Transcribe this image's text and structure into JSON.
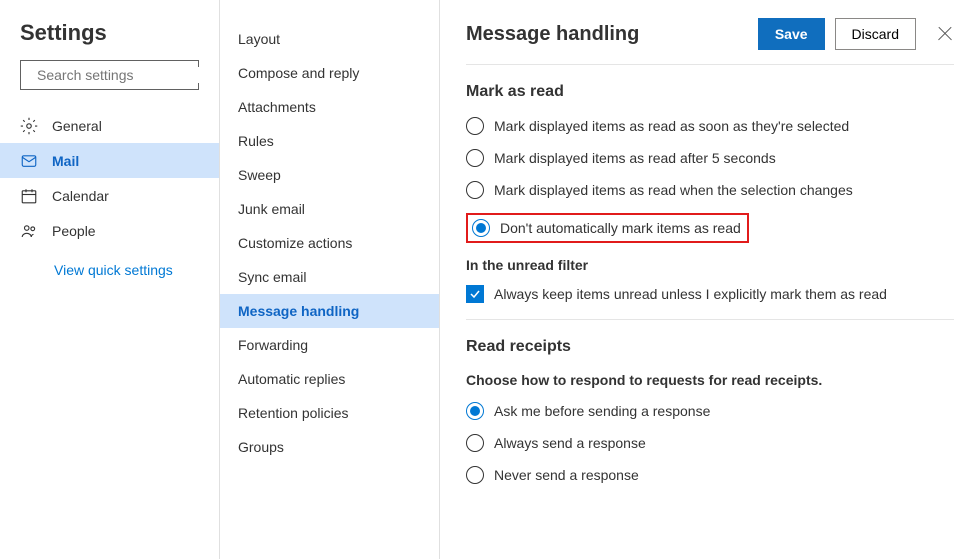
{
  "header": {
    "title": "Settings",
    "search_placeholder": "Search settings",
    "quick_settings": "View quick settings"
  },
  "nav": [
    {
      "label": "General",
      "selected": false
    },
    {
      "label": "Mail",
      "selected": true
    },
    {
      "label": "Calendar",
      "selected": false
    },
    {
      "label": "People",
      "selected": false
    }
  ],
  "subnav": [
    {
      "label": "Layout"
    },
    {
      "label": "Compose and reply"
    },
    {
      "label": "Attachments"
    },
    {
      "label": "Rules"
    },
    {
      "label": "Sweep"
    },
    {
      "label": "Junk email"
    },
    {
      "label": "Customize actions"
    },
    {
      "label": "Sync email"
    },
    {
      "label": "Message handling",
      "selected": true
    },
    {
      "label": "Forwarding"
    },
    {
      "label": "Automatic replies"
    },
    {
      "label": "Retention policies"
    },
    {
      "label": "Groups"
    }
  ],
  "main": {
    "title": "Message handling",
    "save": "Save",
    "discard": "Discard",
    "mark_as_read_heading": "Mark as read",
    "mark_options": [
      {
        "label": "Mark displayed items as read as soon as they're selected",
        "checked": false
      },
      {
        "label": "Mark displayed items as read after 5 seconds",
        "checked": false
      },
      {
        "label": "Mark displayed items as read when the selection changes",
        "checked": false
      },
      {
        "label": "Don't automatically mark items as read",
        "checked": true,
        "highlighted": true
      }
    ],
    "unread_filter_heading": "In the unread filter",
    "unread_checkbox": {
      "label": "Always keep items unread unless I explicitly mark them as read",
      "checked": true
    },
    "read_receipts_heading": "Read receipts",
    "read_receipts_desc": "Choose how to respond to requests for read receipts.",
    "receipt_options": [
      {
        "label": "Ask me before sending a response",
        "checked": true
      },
      {
        "label": "Always send a response",
        "checked": false
      },
      {
        "label": "Never send a response",
        "checked": false
      }
    ]
  }
}
